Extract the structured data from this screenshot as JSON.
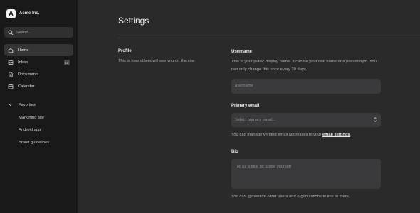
{
  "app": {
    "logo_letter": "A",
    "name": "Acme Inc."
  },
  "search": {
    "placeholder": "Search..."
  },
  "nav": {
    "home": "Home",
    "inbox": "Inbox",
    "inbox_badge": "10",
    "documents": "Documents",
    "calendar": "Calendar"
  },
  "favorites": {
    "label": "Favorites",
    "items": [
      "Marketing site",
      "Android app",
      "Brand guidelines"
    ]
  },
  "page": {
    "title": "Settings"
  },
  "profile": {
    "heading": "Profile",
    "description": "This is how others will see you on the site."
  },
  "username": {
    "label": "Username",
    "help": "This is your public display name. It can be your real name or a pseudonym. You can only change this once every 30 days.",
    "placeholder": "username"
  },
  "email": {
    "label": "Primary email",
    "placeholder": "Select primary email...",
    "help_prefix": "You can manage verified email addresses in your ",
    "help_link": "email settings",
    "help_suffix": "."
  },
  "bio": {
    "label": "Bio",
    "placeholder": "Tell us a little bit about yourself",
    "help": "You can @mention other users and organizations to link to them."
  }
}
